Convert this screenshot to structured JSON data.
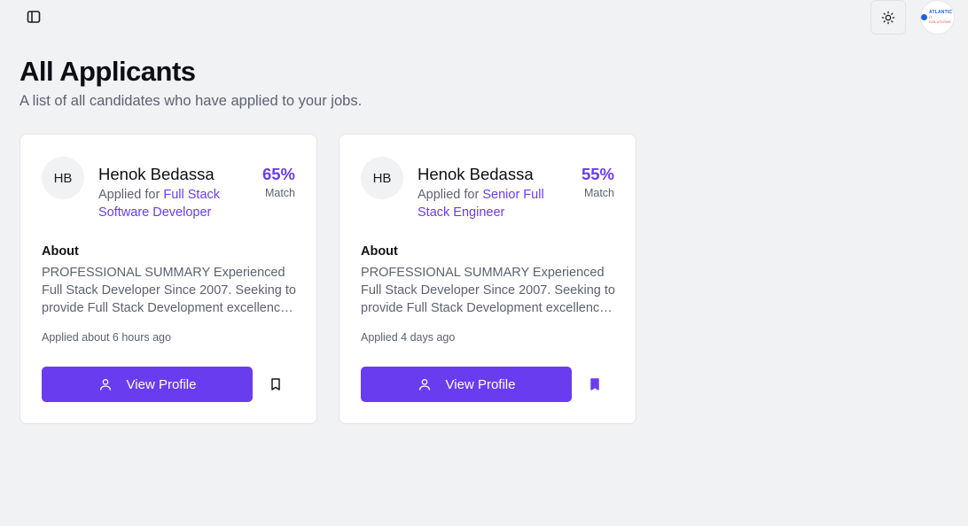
{
  "header": {
    "sidebar_toggle_icon": "panel-left-icon",
    "theme_toggle_icon": "sun-icon",
    "logo": {
      "name": "ATLANTIC",
      "tagline": "IT SOLUTIONS"
    }
  },
  "page": {
    "title": "All Applicants",
    "subtitle": "A list of all candidates who have applied to your jobs."
  },
  "colors": {
    "accent": "#6a3cf0",
    "background": "#f1f2f4",
    "card": "#ffffff"
  },
  "applicants": [
    {
      "initials": "HB",
      "name": "Henok Bedassa",
      "applied_for_prefix": "Applied for",
      "job_title": "Full Stack Software Developer",
      "match_percent": "65%",
      "match_label": "Match",
      "about_heading": "About",
      "about_text": "PROFESSIONAL SUMMARY Experienced Full Stack Developer Since 2007. Seeking to provide Full Stack Development excellence and quality code across the stack.",
      "applied_time": "Applied about 6 hours ago",
      "view_profile_label": "View Profile",
      "bookmarked": false
    },
    {
      "initials": "HB",
      "name": "Henok Bedassa",
      "applied_for_prefix": "Applied for",
      "job_title": "Senior Full Stack Engineer",
      "match_percent": "55%",
      "match_label": "Match",
      "about_heading": "About",
      "about_text": "PROFESSIONAL SUMMARY Experienced Full Stack Developer Since 2007. Seeking to provide Full Stack Development excellence and quality code across the stack.",
      "applied_time": "Applied 4 days ago",
      "view_profile_label": "View Profile",
      "bookmarked": true
    }
  ]
}
